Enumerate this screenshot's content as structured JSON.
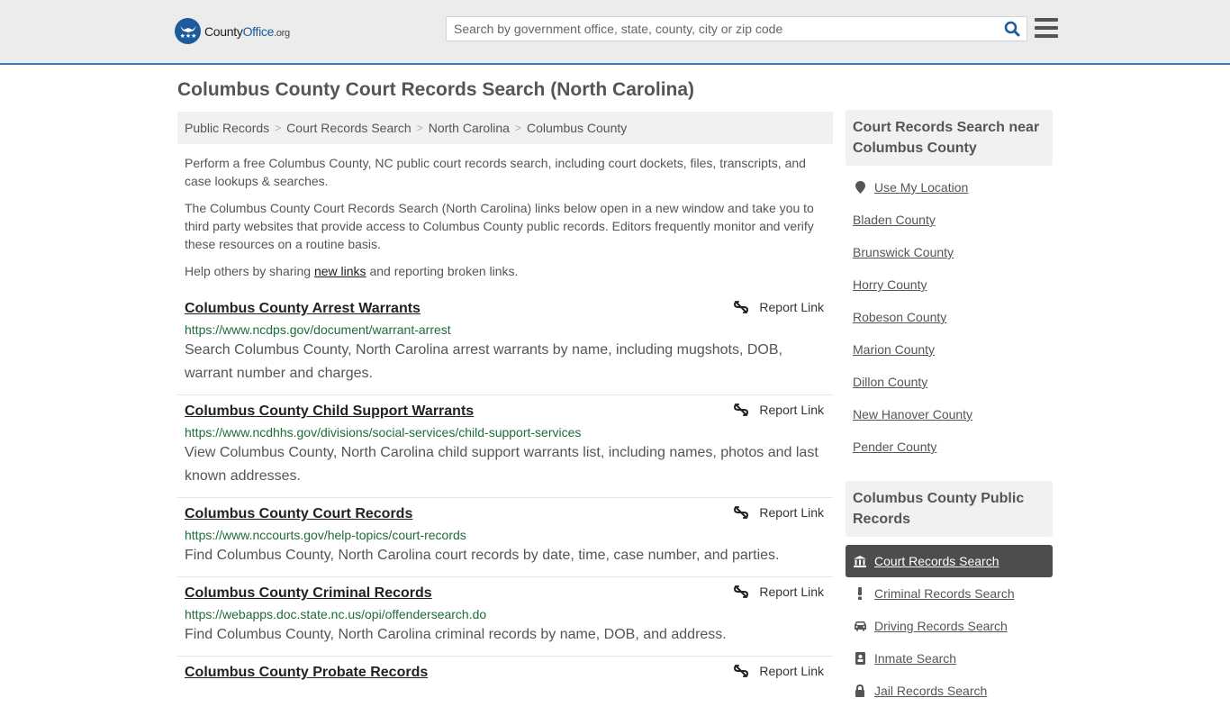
{
  "header": {
    "logo": {
      "name": "County",
      "brand": "Office",
      "tld": ".org"
    },
    "search_placeholder": "Search by government office, state, county, city or zip code",
    "brand_color": "#1d5b9e",
    "accent_border": "#3d7aab"
  },
  "page": {
    "title": "Columbus County Court Records Search (North Carolina)"
  },
  "breadcrumb": [
    {
      "label": "Public Records"
    },
    {
      "label": "Court Records Search"
    },
    {
      "label": "North Carolina"
    },
    {
      "label": "Columbus County"
    }
  ],
  "breadcrumb_separator": ">",
  "intro": {
    "p1": "Perform a free Columbus County, NC public court records search, including court dockets, files, transcripts, and case lookups & searches.",
    "p2": "The Columbus County Court Records Search (North Carolina) links below open in a new window and take you to third party websites that provide access to Columbus County public records. Editors frequently monitor and verify these resources on a routine basis.",
    "p3_before": "Help others by sharing ",
    "p3_link": "new links",
    "p3_after": " and reporting broken links."
  },
  "report_label": "Report Link",
  "results": [
    {
      "title": "Columbus County Arrest Warrants",
      "url": "https://www.ncdps.gov/document/warrant-arrest",
      "description": "Search Columbus County, North Carolina arrest warrants by name, including mugshots, DOB, warrant number and charges."
    },
    {
      "title": "Columbus County Child Support Warrants",
      "url": "https://www.ncdhhs.gov/divisions/social-services/child-support-services",
      "description": "View Columbus County, North Carolina child support warrants list, including names, photos and last known addresses."
    },
    {
      "title": "Columbus County Court Records",
      "url": "https://www.nccourts.gov/help-topics/court-records",
      "description": "Find Columbus County, North Carolina court records by date, time, case number, and parties."
    },
    {
      "title": "Columbus County Criminal Records",
      "url": "https://webapps.doc.state.nc.us/opi/offendersearch.do",
      "description": "Find Columbus County, North Carolina criminal records by name, DOB, and address."
    },
    {
      "title": "Columbus County Probate Records",
      "url": "",
      "description": ""
    }
  ],
  "sidebar": {
    "nearby_heading": "Court Records Search near Columbus County",
    "use_location": "Use My Location",
    "nearby": [
      "Bladen County",
      "Brunswick County",
      "Horry County",
      "Robeson County",
      "Marion County",
      "Dillon County",
      "New Hanover County",
      "Pender County"
    ],
    "public_records_heading": "Columbus County Public Records",
    "public_records": [
      {
        "label": "Court Records Search",
        "icon": "courthouse-icon",
        "active": true
      },
      {
        "label": "Criminal Records Search",
        "icon": "exclamation-icon",
        "active": false
      },
      {
        "label": "Driving Records Search",
        "icon": "car-icon",
        "active": false
      },
      {
        "label": "Inmate Search",
        "icon": "id-badge-icon",
        "active": false
      },
      {
        "label": "Jail Records Search",
        "icon": "lock-icon",
        "active": false
      }
    ]
  }
}
